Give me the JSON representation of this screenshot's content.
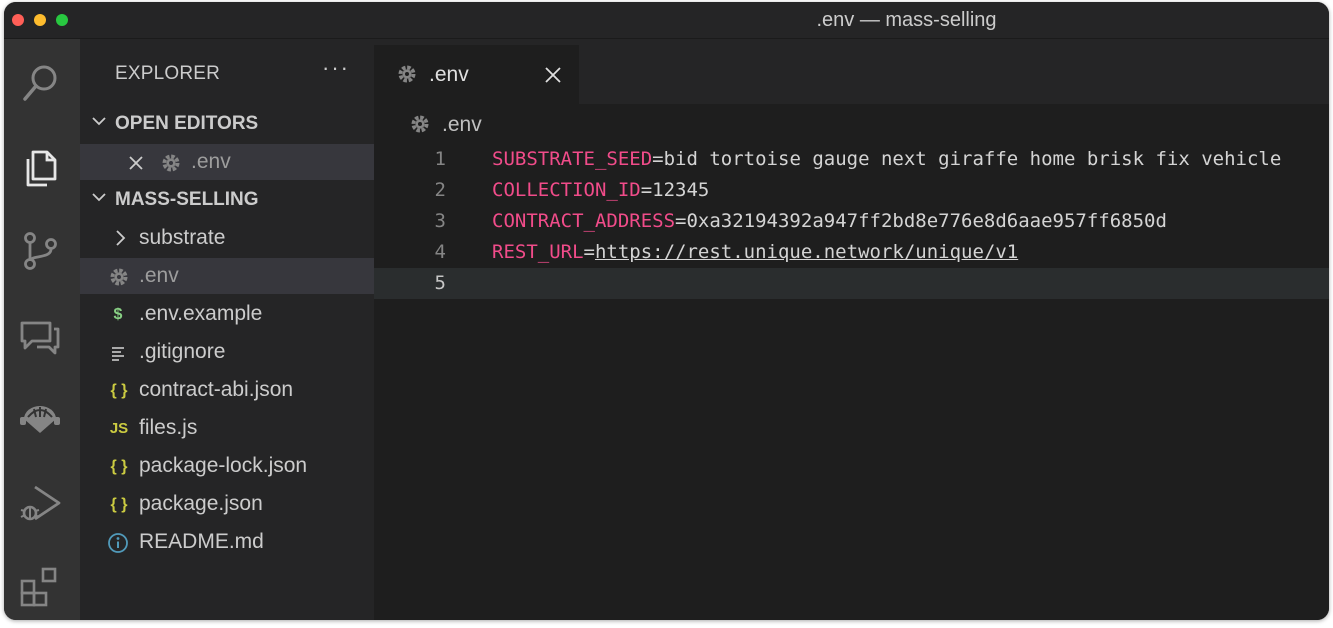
{
  "window": {
    "title": ".env — mass-selling"
  },
  "activity_bar": {
    "items": [
      "search-icon",
      "explorer-icon",
      "source-control-icon",
      "comments-icon",
      "extension-icon",
      "run-debug-icon",
      "extensions-icon"
    ]
  },
  "sidebar": {
    "header": "EXPLORER",
    "more": "···",
    "open_editors_label": "OPEN EDITORS",
    "open_editors": [
      {
        "name": ".env",
        "icon": "gear-icon"
      }
    ],
    "project_label": "MASS-SELLING",
    "files": [
      {
        "name": "substrate",
        "icon": "chevron-right-icon",
        "kind": "folder"
      },
      {
        "name": ".env",
        "icon": "gear-icon",
        "kind": "file"
      },
      {
        "name": ".env.example",
        "icon": "dollar-icon",
        "glyph": "$",
        "color": "#89d185",
        "kind": "file"
      },
      {
        "name": ".gitignore",
        "icon": "lines-icon",
        "kind": "file"
      },
      {
        "name": "contract-abi.json",
        "icon": "json-icon",
        "glyph": "{ }",
        "color": "#cbcb41",
        "kind": "file"
      },
      {
        "name": "files.js",
        "icon": "js-icon",
        "glyph": "JS",
        "color": "#cbcb41",
        "kind": "file"
      },
      {
        "name": "package-lock.json",
        "icon": "json-icon",
        "glyph": "{ }",
        "color": "#cbcb41",
        "kind": "file"
      },
      {
        "name": "package.json",
        "icon": "json-icon",
        "glyph": "{ }",
        "color": "#cbcb41",
        "kind": "file"
      },
      {
        "name": "README.md",
        "icon": "info-icon",
        "color": "#519aba",
        "kind": "file"
      }
    ]
  },
  "editor": {
    "tab_label": ".env",
    "breadcrumb": ".env",
    "lines": [
      {
        "number": "1",
        "key": "SUBSTRATE_SEED",
        "eq": "=",
        "value": "bid tortoise gauge next giraffe home brisk fix vehicle"
      },
      {
        "number": "2",
        "key": "COLLECTION_ID",
        "eq": "=",
        "value": "12345"
      },
      {
        "number": "3",
        "key": "CONTRACT_ADDRESS",
        "eq": "=",
        "value": "0xa32194392a947ff2bd8e776e8d6aae957ff6850d"
      },
      {
        "number": "4",
        "key": "REST_URL",
        "eq": "=",
        "value": "https://rest.unique.network/unique/v1"
      },
      {
        "number": "5",
        "key": "",
        "eq": "",
        "value": ""
      }
    ]
  },
  "colors": {
    "key": "#f14c8a",
    "text": "#d4d4d4",
    "background": "#1e1e1e"
  }
}
